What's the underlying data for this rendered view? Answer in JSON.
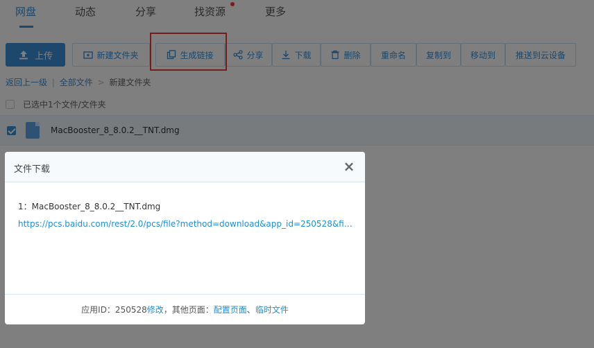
{
  "nav": {
    "tabs": [
      "网盘",
      "动态",
      "分享",
      "找资源",
      "更多"
    ],
    "active_index": 0
  },
  "toolbar": {
    "upload_label": "上传",
    "buttons": [
      "新建文件夹",
      "生成链接",
      "分享",
      "下载",
      "删除",
      "重命名",
      "复制到",
      "移动到",
      "推送到云设备"
    ]
  },
  "breadcrumb": {
    "back": "返回上一级",
    "all_files": "全部文件",
    "separator": ">",
    "current": "新建文件夹"
  },
  "selection": {
    "summary": "已选中1个文件/文件夹"
  },
  "file": {
    "name": "MacBooster_8_8.0.2__TNT.dmg",
    "checked": true
  },
  "dialog": {
    "title": "文件下载",
    "close": "×",
    "item": "1：MacBooster_8_8.0.2__TNT.dmg",
    "link": "https://pcs.baidu.com/rest/2.0/pcs/file?method=download&app_id=250528&file...",
    "footer_prefix": "应用ID：250528 ",
    "footer_modify": "修改",
    "footer_mid": "，其他页面：",
    "footer_config": "配置页面",
    "footer_sep": " 、",
    "footer_temp": "临时文件"
  },
  "colors": {
    "accent": "#3a8fd6",
    "highlight": "#e8383d",
    "notification_dot": "#f5363b"
  }
}
